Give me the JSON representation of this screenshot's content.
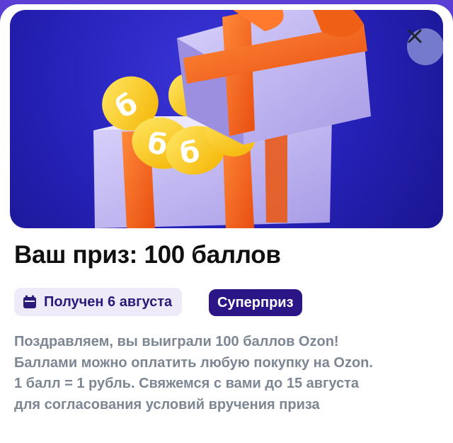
{
  "hero": {
    "image_icon": "gift-box-with-coins",
    "coin_glyph": "б",
    "colors": {
      "background": "#2621b7",
      "box": "#c5bcf0",
      "ribbon": "#ff6a21",
      "coin": "#ffd21f"
    }
  },
  "close_button": {
    "icon": "close-icon",
    "glyph": "✕"
  },
  "prize": {
    "title": "Ваш приз: 100 баллов",
    "received_icon": "calendar-icon",
    "received_label": "Получен 6 августа",
    "badge": "Суперприз",
    "description_lines": [
      "Поздравляем, вы выиграли 100 баллов Ozon!",
      "Баллами можно оплатить любую покупку на Ozon.",
      "1 балл = 1 рубль. Свяжемся с вами до 15 августа",
      "для согласования условий вручения приза"
    ]
  }
}
